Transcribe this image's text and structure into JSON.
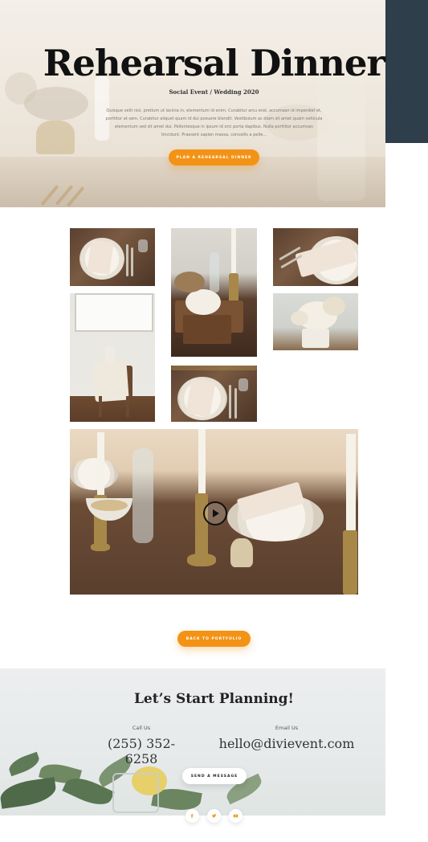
{
  "hero": {
    "title": "Rehearsal Dinner",
    "subtitle": "Social Event / Wedding 2020",
    "body": "Quisque velit nisi, pretium ut lacinia in, elementum id enim. Curabitur arcu erat, accumsan id imperdiet et, porttitor at sem. Curabitur aliquet quam id dui posuere blandit. Vestibulum ac diam sit amet quam vehicula elementum sed sit amet dui. Pellentesque in ipsum id orci porta dapibus. Nulla porttitor accumsan tincidunt. Praesent sapien massa, convallis a pelle...",
    "button": "Plan a Rehearsal Dinner"
  },
  "gallery": {
    "photos": [
      {
        "name": "place-setting-photo"
      },
      {
        "name": "cheese-board-photo"
      },
      {
        "name": "napkin-plate-photo"
      },
      {
        "name": "chair-window-photo"
      },
      {
        "name": "floral-arrangement-photo"
      },
      {
        "name": "table-setting-photo"
      }
    ]
  },
  "video": {
    "play_icon": "play-icon"
  },
  "back_button": "Back to Portfolio",
  "contact": {
    "title": "Let’s Start Planning!",
    "call_label": "Call Us",
    "phone": "(255) 352-6258",
    "email_label": "Email Us",
    "email": "hello@divievent.com",
    "button": "Send a Message"
  },
  "social": [
    "facebook-icon",
    "twitter-icon",
    "youtube-icon"
  ],
  "colors": {
    "accent": "#f39316",
    "dark_panel": "#2e3e4a",
    "title": "#111111"
  }
}
